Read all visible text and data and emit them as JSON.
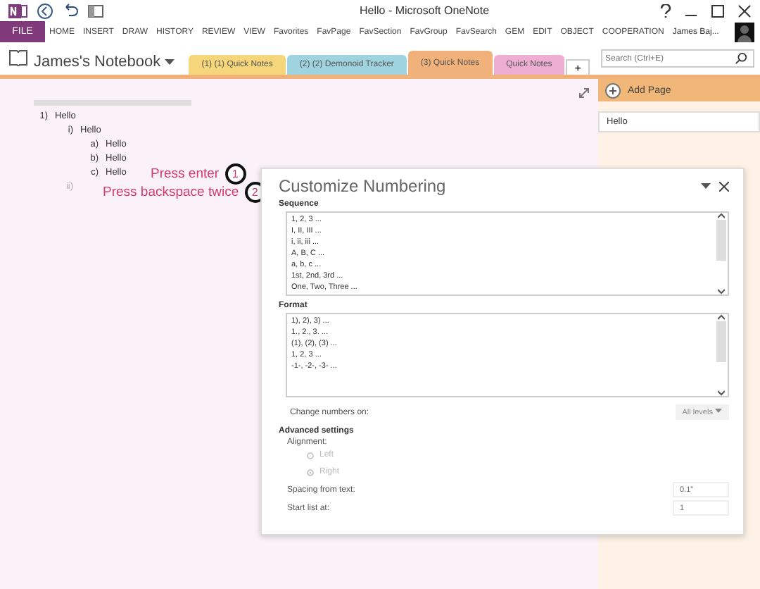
{
  "window": {
    "title": "Hello - Microsoft OneNote"
  },
  "ribbon": {
    "file": "FILE",
    "tabs": [
      "HOME",
      "INSERT",
      "DRAW",
      "HISTORY",
      "REVIEW",
      "VIEW",
      "Favorites",
      "FavPage",
      "FavSection",
      "FavGroup",
      "FavSearch",
      "GEM",
      "EDIT",
      "OBJECT",
      "COOPERATION"
    ],
    "user": "James Baj..."
  },
  "notebook": {
    "name": "James's Notebook",
    "sections": [
      {
        "label": "(1) (1) Quick Notes",
        "color": "#f6d67a",
        "selected": false
      },
      {
        "label": "(2) (2) Demonoid Tracker",
        "color": "#9fd3e0",
        "selected": false
      },
      {
        "label": "(3) Quick Notes",
        "color": "#f0b27a",
        "selected": true
      },
      {
        "label": "Quick Notes",
        "color": "#eeaed3",
        "selected": false
      }
    ],
    "add_label": "+"
  },
  "search": {
    "placeholder": "Search (Ctrl+E)"
  },
  "note": {
    "items": [
      {
        "marker": "1)",
        "text": "Hello",
        "children": [
          {
            "marker": "i)",
            "text": "Hello",
            "children": [
              {
                "marker": "a)",
                "text": "Hello"
              },
              {
                "marker": "b)",
                "text": "Hello"
              },
              {
                "marker": "c)",
                "text": "Hello"
              }
            ]
          },
          {
            "marker": "ii)",
            "pending": true
          }
        ]
      }
    ]
  },
  "annotations": [
    {
      "text": "Press enter",
      "step": "1"
    },
    {
      "text": "Press backspace twice",
      "step": "2"
    }
  ],
  "pages_pane": {
    "add_page": "Add Page",
    "pages": [
      {
        "title": "Hello",
        "selected": true
      }
    ]
  },
  "dialog": {
    "title": "Customize Numbering",
    "sequence_label": "Sequence",
    "sequence": [
      {
        "text": "1, 2, 3 ...",
        "selected": false
      },
      {
        "text": "I, II, III ...",
        "selected": false
      },
      {
        "text": "i, ii, iii ...",
        "selected": false
      },
      {
        "text": "A, B, C ...",
        "selected": false
      },
      {
        "text": "a, b, c ...",
        "selected": false
      },
      {
        "text": "1st, 2nd, 3rd ...",
        "selected": false
      },
      {
        "text": "One, Two, Three ...",
        "selected": false
      }
    ],
    "format_label": "Format",
    "format": [
      {
        "text": "1), 2), 3) ...",
        "selected": false
      },
      {
        "text": "1., 2., 3. ...",
        "selected": false
      },
      {
        "text": "(1), (2), (3) ...",
        "selected": false
      },
      {
        "text": "1, 2, 3 ...",
        "selected": false
      },
      {
        "text": "-1-, -2-, -3- ...",
        "selected": false
      }
    ],
    "change_label": "Change numbers on:",
    "change_value": "All levels",
    "advanced_label": "Advanced settings",
    "alignment_label": "Alignment:",
    "alignment": [
      {
        "label": "Left",
        "selected": false,
        "disabled": true
      },
      {
        "label": "Right",
        "selected": true,
        "disabled": true
      }
    ],
    "spacing_label": "Spacing from text:",
    "spacing_value": "0.1\"",
    "start_label": "Start list at:",
    "start_value": "1"
  }
}
